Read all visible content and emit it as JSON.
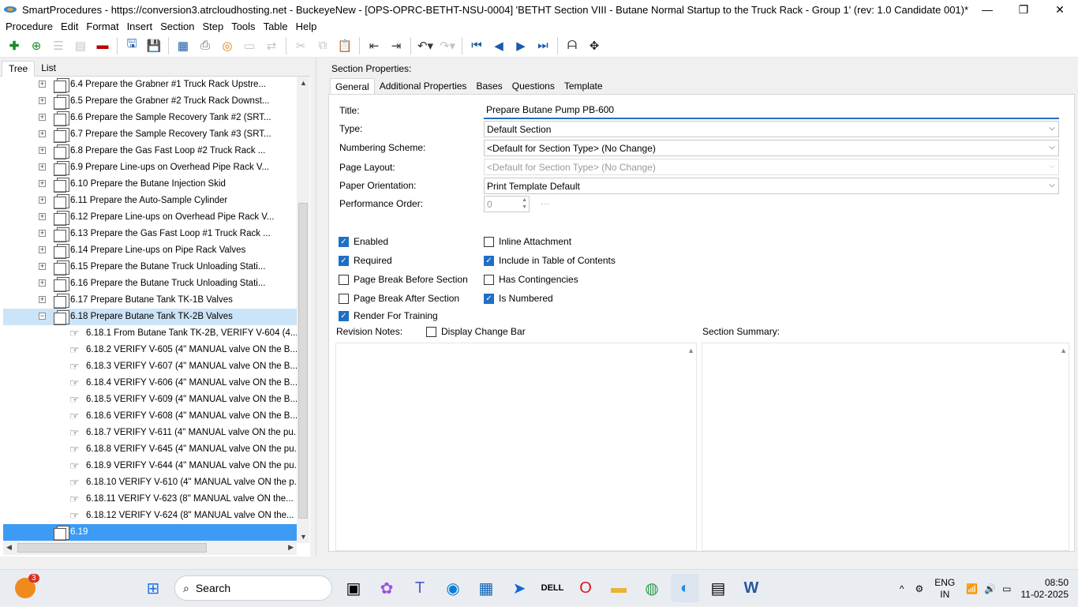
{
  "window": {
    "title": "SmartProcedures - https://conversion3.atrcloudhosting.net - BuckeyeNew - [OPS-OPRC-BETHT-NSU-0004] 'BETHT Section VIII - Butane Normal Startup to the Truck Rack - Group 1' (rev: 1.0 Candidate 001)*",
    "minimize": "—",
    "maximize": "❐",
    "close": "✕"
  },
  "menu": [
    "Procedure",
    "Edit",
    "Format",
    "Insert",
    "Section",
    "Step",
    "Tools",
    "Table",
    "Help"
  ],
  "left_tabs": {
    "tree": "Tree",
    "list": "List"
  },
  "tree": {
    "sections": [
      "6.4 Prepare the Grabner #1 Truck Rack Upstre...",
      "6.5 Prepare the Grabner #2 Truck Rack Downst...",
      "6.6 Prepare the Sample Recovery Tank #2 (SRT...",
      "6.7 Prepare the Sample Recovery Tank #3 (SRT...",
      "6.8 Prepare the Gas Fast Loop #2 Truck Rack ...",
      "6.9 Prepare Line-ups on Overhead Pipe Rack V...",
      "6.10 Prepare the Butane Injection Skid",
      "6.11 Prepare the Auto-Sample Cylinder",
      "6.12 Prepare Line-ups on Overhead Pipe Rack V...",
      "6.13 Prepare the Gas Fast Loop #1 Truck Rack ...",
      "6.14 Prepare Line-ups on Pipe Rack Valves",
      "6.15 Prepare the Butane Truck Unloading Stati...",
      "6.16 Prepare the Butane Truck Unloading Stati...",
      "6.17 Prepare Butane Tank TK-1B Valves"
    ],
    "expanded_section": "6.18 Prepare Butane Tank TK-2B Valves",
    "steps": [
      "6.18.1  From Butane Tank TK-2B, VERIFY V-604 (4...",
      "6.18.2  VERIFY V-605 (4\" MANUAL valve ON the B...",
      "6.18.3  VERIFY V-607 (4\" MANUAL valve ON the B...",
      "6.18.4  VERIFY V-606 (4\" MANUAL valve ON the B...",
      "6.18.5  VERIFY V-609 (4\" MANUAL valve ON the B...",
      "6.18.6  VERIFY V-608 (4\" MANUAL valve ON the B...",
      "6.18.7  VERIFY V-611 (4\" MANUAL valve ON the pu...",
      "6.18.8  VERIFY V-645 (4\" MANUAL valve ON the pu...",
      "6.18.9  VERIFY V-644 (4\" MANUAL valve ON the pu...",
      "6.18.10  VERIFY V-610 (4\" MANUAL valve ON the p...",
      "6.18.11  VERIFY V-623 (8\" MANUAL valve ON the...",
      "6.18.12  VERIFY V-624 (8\" MANUAL valve ON the..."
    ],
    "selected_node": "6.19"
  },
  "section_properties": {
    "heading": "Section Properties:",
    "tabs": [
      "General",
      "Additional Properties",
      "Bases",
      "Questions",
      "Template"
    ],
    "labels": {
      "title": "Title:",
      "type": "Type:",
      "numbering": "Numbering Scheme:",
      "layout": "Page Layout:",
      "orientation": "Paper Orientation:",
      "perf_order": "Performance Order:"
    },
    "values": {
      "title": "Prepare Butane Pump PB-600",
      "type": "Default Section",
      "numbering": "<Default for Section Type> (No Change)",
      "layout": "<Default for Section Type> (No Change)",
      "orientation": "Print Template Default",
      "perf_order": "0"
    },
    "checkboxes": {
      "enabled": {
        "label": "Enabled",
        "checked": true
      },
      "required": {
        "label": "Required",
        "checked": true
      },
      "page_break_before": {
        "label": "Page Break Before Section",
        "checked": false
      },
      "page_break_after": {
        "label": "Page Break After Section",
        "checked": false
      },
      "render_training": {
        "label": "Render For Training",
        "checked": true
      },
      "inline_attachment": {
        "label": "Inline Attachment",
        "checked": false
      },
      "include_toc": {
        "label": "Include in Table of Contents",
        "checked": true
      },
      "has_contingencies": {
        "label": "Has Contingencies",
        "checked": false
      },
      "is_numbered": {
        "label": "Is Numbered",
        "checked": true
      },
      "display_change_bar": {
        "label": "Display Change Bar",
        "checked": false
      }
    },
    "revision_notes_label": "Revision Notes:",
    "section_summary_label": "Section Summary:"
  },
  "taskbar": {
    "search_label": "Search",
    "notification_count": "3",
    "lang_top": "ENG",
    "lang_bottom": "IN",
    "time": "08:50",
    "date": "11-02-2025"
  },
  "colors": {
    "accent": "#1f6fc5",
    "selection": "#3d9bf3",
    "selected_light": "#cce4f7"
  }
}
